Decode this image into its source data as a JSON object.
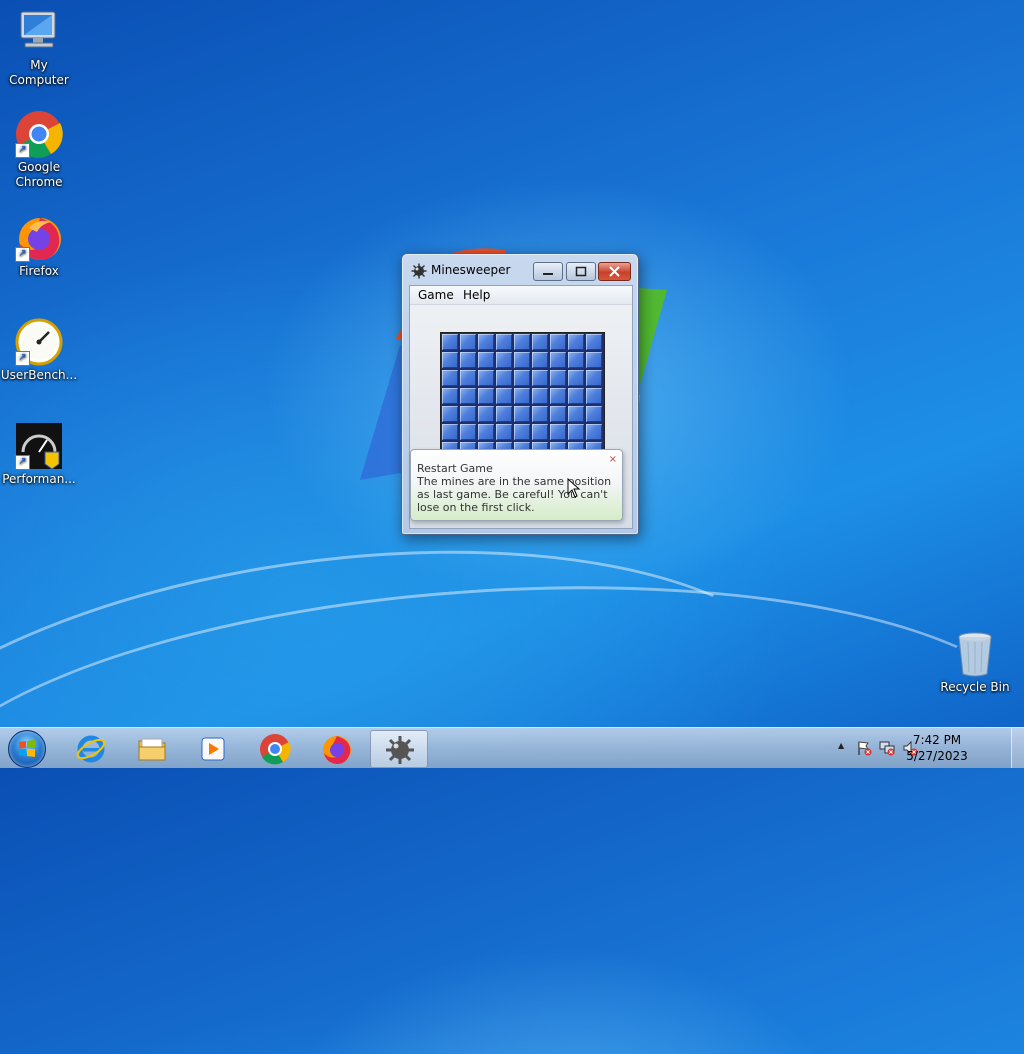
{
  "desktop": {
    "icons": [
      {
        "label": "My Computer",
        "icon": "computer-icon"
      },
      {
        "label": "Google Chrome",
        "icon": "chrome-icon"
      },
      {
        "label": "Firefox",
        "icon": "firefox-icon"
      },
      {
        "label": "UserBench...",
        "icon": "userbenchmark-icon"
      },
      {
        "label": "Performan...",
        "icon": "performance-icon"
      },
      {
        "label": "Recycle Bin",
        "icon": "recycle-bin-icon"
      }
    ]
  },
  "window": {
    "title": "Minesweeper",
    "menu": [
      "Game",
      "Help"
    ],
    "board": {
      "columns": 9,
      "visible_rows": 7
    }
  },
  "balloon": {
    "title": "Restart Game",
    "text": "The mines are in the same position as last game. Be careful! You can't lose on the first click.",
    "close": "×"
  },
  "taskbar": {
    "apps": [
      "internet-explorer-icon",
      "file-explorer-icon",
      "media-player-icon",
      "chrome-icon",
      "firefox-icon",
      "minesweeper-icon"
    ],
    "active_app": "minesweeper-icon",
    "clock": {
      "time": "7:42 PM",
      "date": "5/27/2023"
    },
    "tray": {
      "show_hidden": "▲"
    }
  },
  "colors": {
    "accent": "#1a79d8",
    "taskbar": "#a8bfdb",
    "close_button": "#c8412a"
  }
}
